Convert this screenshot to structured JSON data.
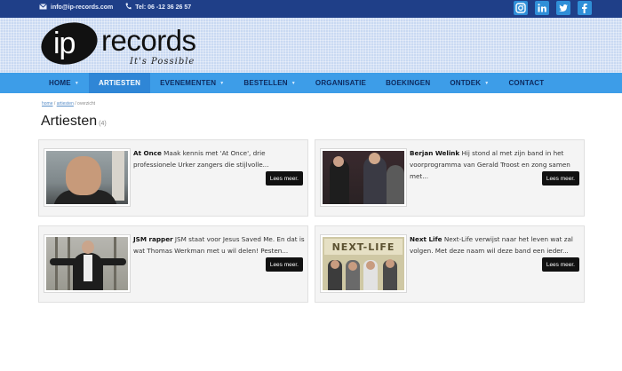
{
  "topbar": {
    "email": "info@ip-records.com",
    "phone": "Tel: 06 -12 36 26 57",
    "socials": [
      "instagram-icon",
      "linkedin-icon",
      "twitter-icon",
      "facebook-icon"
    ]
  },
  "logo": {
    "ip": "ip",
    "records": "records",
    "tagline": "It's Possible"
  },
  "nav": {
    "items": [
      {
        "label": "HOME",
        "has_dropdown": true
      },
      {
        "label": "ARTIESTEN",
        "has_dropdown": false,
        "active": true
      },
      {
        "label": "EVENEMENTEN",
        "has_dropdown": true
      },
      {
        "label": "BESTELLEN",
        "has_dropdown": true
      },
      {
        "label": "ORGANISATIE",
        "has_dropdown": false
      },
      {
        "label": "BOEKINGEN",
        "has_dropdown": false
      },
      {
        "label": "ONTDEK",
        "has_dropdown": true
      },
      {
        "label": "CONTACT",
        "has_dropdown": false
      }
    ]
  },
  "breadcrumb": {
    "home": "home",
    "sep1": " / ",
    "artiesten": "artiesten",
    "sep2": " / ",
    "current": "overzicht"
  },
  "page": {
    "title": "Artiesten",
    "count": "(4)"
  },
  "cards": [
    {
      "name": "At Once",
      "description": "Maak kennis met 'At Once', drie professionele Urker zangers die stijlvolle...",
      "button": "Lees meer."
    },
    {
      "name": "Berjan Welink",
      "description": "Hij stond al met zijn band in het voorprogramma van Gerald Troost en zong samen met...",
      "button": "Lees meer."
    },
    {
      "name": "JSM rapper",
      "description": "JSM staat voor Jesus Saved Me. En dat is wat Thomas Werkman met u wil delen! Pesten...",
      "button": "Lees meer."
    },
    {
      "name": "Next Life",
      "description": "Next-Life verwijst naar het leven wat zal volgen. Met deze naam wil deze band een ieder...",
      "button": "Lees meer."
    }
  ],
  "photo_text": {
    "next_life_sign": "NEXT-LIFE"
  },
  "colors": {
    "topbar": "#1f3f88",
    "nav": "#3d9de8",
    "nav_active": "#2f86d6",
    "social": "#2f8fd8",
    "button": "#111111"
  }
}
